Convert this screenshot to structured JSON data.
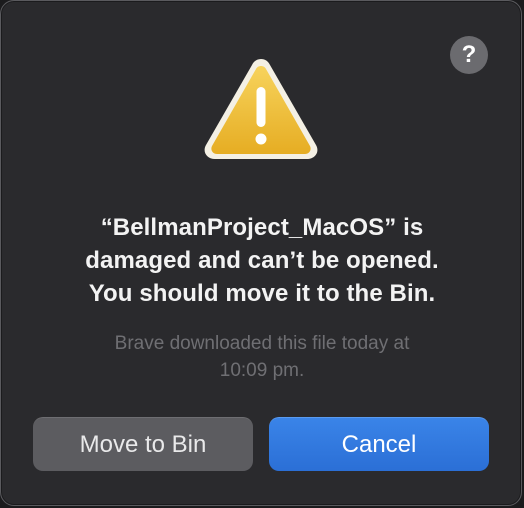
{
  "dialog": {
    "help_label": "?",
    "icon": "warning-triangle-icon",
    "message_lines": [
      "“BellmanProject_MacOS” is",
      "damaged and can’t be opened.",
      "You should move it to the Bin."
    ],
    "info_lines": [
      "Brave downloaded this file today at",
      "10:09 pm."
    ],
    "buttons": {
      "move_label": "Move to Bin",
      "cancel_label": "Cancel"
    }
  },
  "colors": {
    "background": "#2a2a2d",
    "accent": "#2f74dc",
    "warning": "#f3c33b"
  }
}
